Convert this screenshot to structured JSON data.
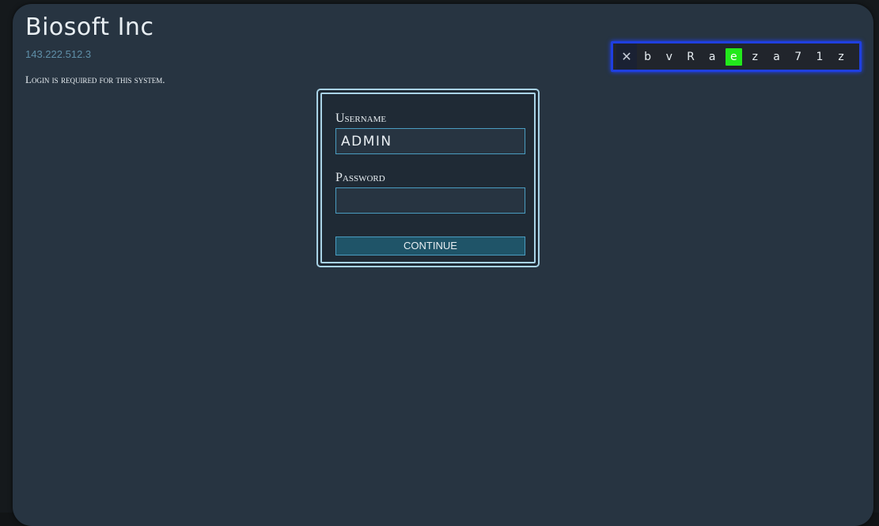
{
  "header": {
    "title": "Biosoft Inc",
    "ip": "143.222.512.3",
    "notice": "Login is required for this system."
  },
  "login": {
    "username_label": "Username",
    "username_value": "ADMIN",
    "password_label": "Password",
    "password_value": "",
    "continue_label": "CONTINUE"
  },
  "keystrip": {
    "close_symbol": "✕",
    "keys": [
      "b",
      "v",
      "R",
      "a",
      "e",
      "z",
      "a",
      "7",
      "1",
      "z"
    ],
    "active_index": 4,
    "active_color": "#22e81c",
    "border_color": "#1f3fe0"
  },
  "colors": {
    "panel": "#273441",
    "accent": "#a9d3e6",
    "button": "#1f5468"
  }
}
